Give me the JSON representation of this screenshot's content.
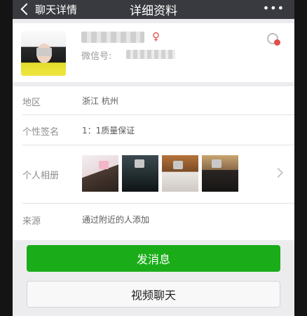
{
  "nav": {
    "back_label": "聊天详情",
    "title": "详细资料",
    "more_label": "•••"
  },
  "profile": {
    "wechat_id_label": "微信号:"
  },
  "info": {
    "region": {
      "label": "地区",
      "value": "浙江  杭州"
    },
    "signature": {
      "label": "个性签名",
      "value": "1：1质量保证"
    },
    "album": {
      "label": "个人相册"
    },
    "source": {
      "label": "来源",
      "value": "通过附近的人添加"
    }
  },
  "buttons": {
    "send_message": "发消息",
    "video_chat": "视频聊天"
  },
  "colors": {
    "nav_bar": "#393a3f",
    "primary_green": "#1aad19"
  }
}
